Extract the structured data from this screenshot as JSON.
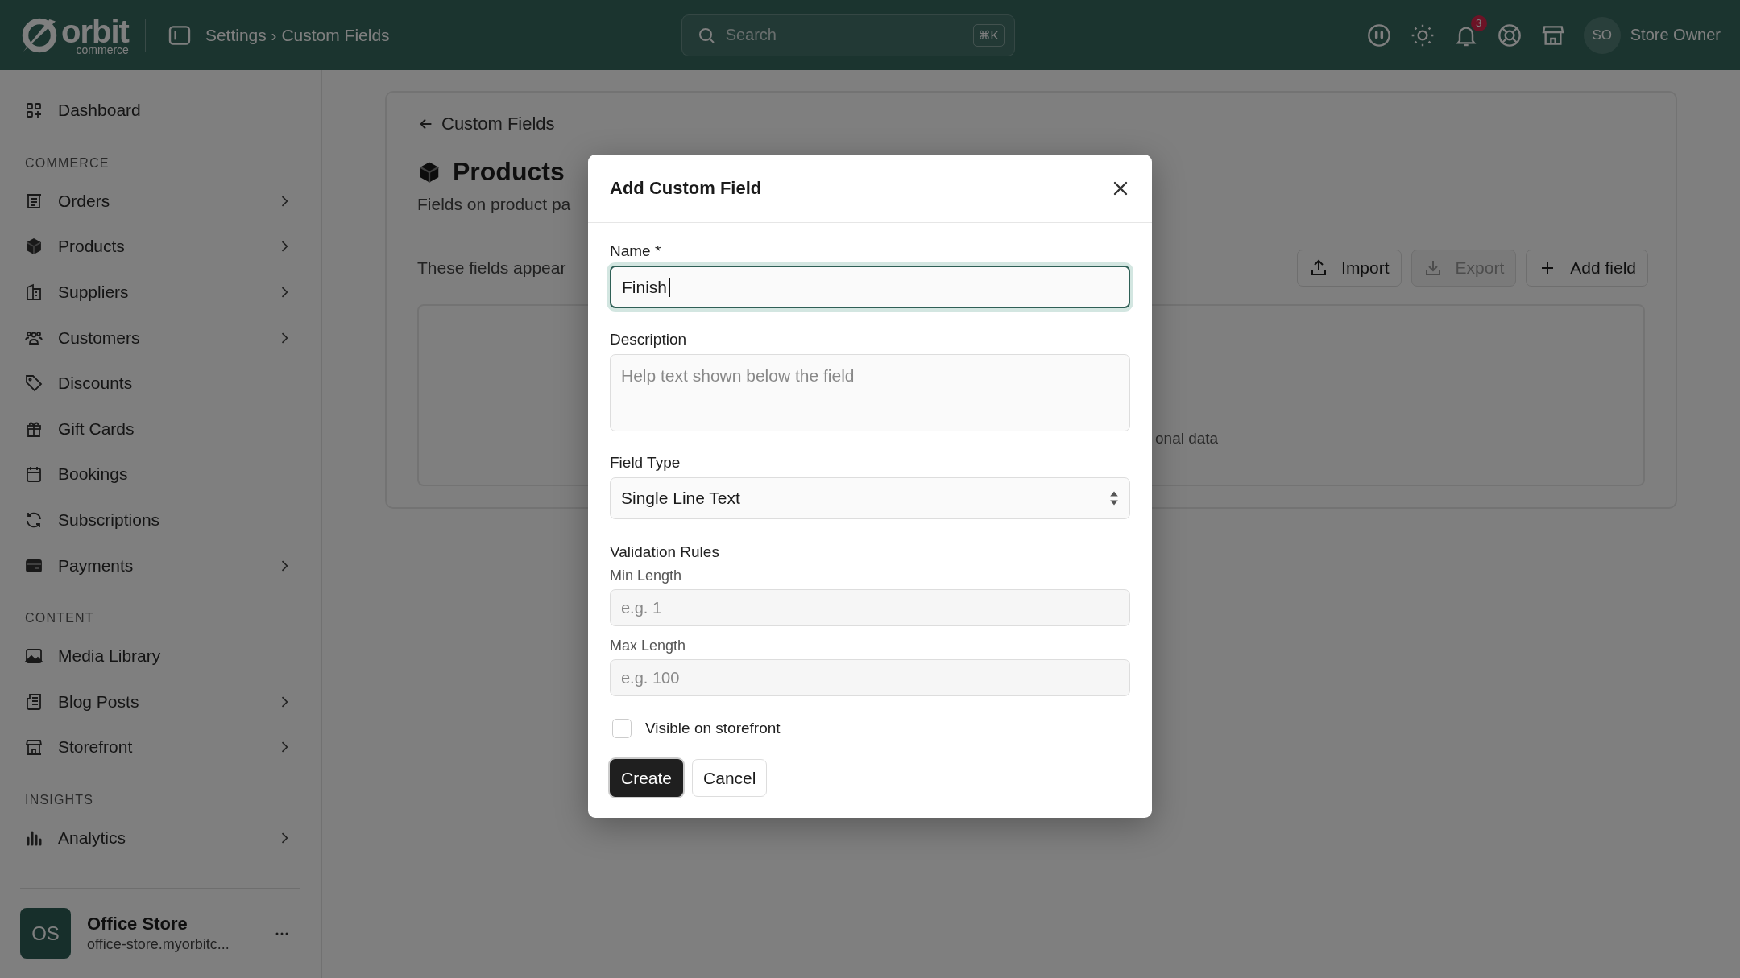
{
  "topbar": {
    "logo_text": "orbit",
    "logo_sub": "commerce",
    "breadcrumb": "Settings › Custom Fields",
    "search": {
      "placeholder": "Search",
      "shortcut": "⌘K"
    },
    "notification_count": "3",
    "user": {
      "initials": "SO",
      "name": "Store Owner"
    }
  },
  "sidebar": {
    "sections": [
      {
        "items": [
          {
            "label": "Dashboard",
            "has_submenu": false
          }
        ]
      },
      {
        "heading": "COMMERCE",
        "items": [
          {
            "label": "Orders",
            "has_submenu": true
          },
          {
            "label": "Products",
            "has_submenu": true
          },
          {
            "label": "Suppliers",
            "has_submenu": true
          },
          {
            "label": "Customers",
            "has_submenu": true
          },
          {
            "label": "Discounts",
            "has_submenu": false
          },
          {
            "label": "Gift Cards",
            "has_submenu": false
          },
          {
            "label": "Bookings",
            "has_submenu": false
          },
          {
            "label": "Subscriptions",
            "has_submenu": false
          },
          {
            "label": "Payments",
            "has_submenu": true
          }
        ]
      },
      {
        "heading": "CONTENT",
        "items": [
          {
            "label": "Media Library",
            "has_submenu": false
          },
          {
            "label": "Blog Posts",
            "has_submenu": true
          },
          {
            "label": "Storefront",
            "has_submenu": true
          }
        ]
      },
      {
        "heading": "INSIGHTS",
        "items": [
          {
            "label": "Analytics",
            "has_submenu": true
          }
        ]
      }
    ],
    "store": {
      "initials": "OS",
      "name": "Office Store",
      "domain": "office-store.myorbitc..."
    }
  },
  "page": {
    "back_link": "Custom Fields",
    "title": "Products",
    "subtitle": "Fields on product pa",
    "intro": "These fields appear",
    "buttons": [
      {
        "label": "Import",
        "disabled": false
      },
      {
        "label": "Export",
        "disabled": true
      },
      {
        "label": "Add field",
        "disabled": false
      }
    ],
    "empty_state_text": "onal data"
  },
  "modal": {
    "title": "Add Custom Field",
    "fields": [
      {
        "kind": "text",
        "label": "Name *",
        "value": "Finish",
        "focused": true
      },
      {
        "kind": "textarea",
        "label": "Description",
        "placeholder": "Help text shown below the field"
      },
      {
        "kind": "select",
        "label": "Field Type",
        "value": "Single Line Text"
      },
      {
        "kind": "heading",
        "label": "Validation Rules"
      },
      {
        "kind": "small-text",
        "label": "Min Length",
        "placeholder": "e.g. 1"
      },
      {
        "kind": "small-text",
        "label": "Max Length",
        "placeholder": "e.g. 100"
      },
      {
        "kind": "checkbox",
        "label": "Visible on storefront",
        "checked": false
      }
    ],
    "actions": [
      {
        "label": "Create",
        "primary": true
      },
      {
        "label": "Cancel",
        "primary": false
      }
    ]
  }
}
